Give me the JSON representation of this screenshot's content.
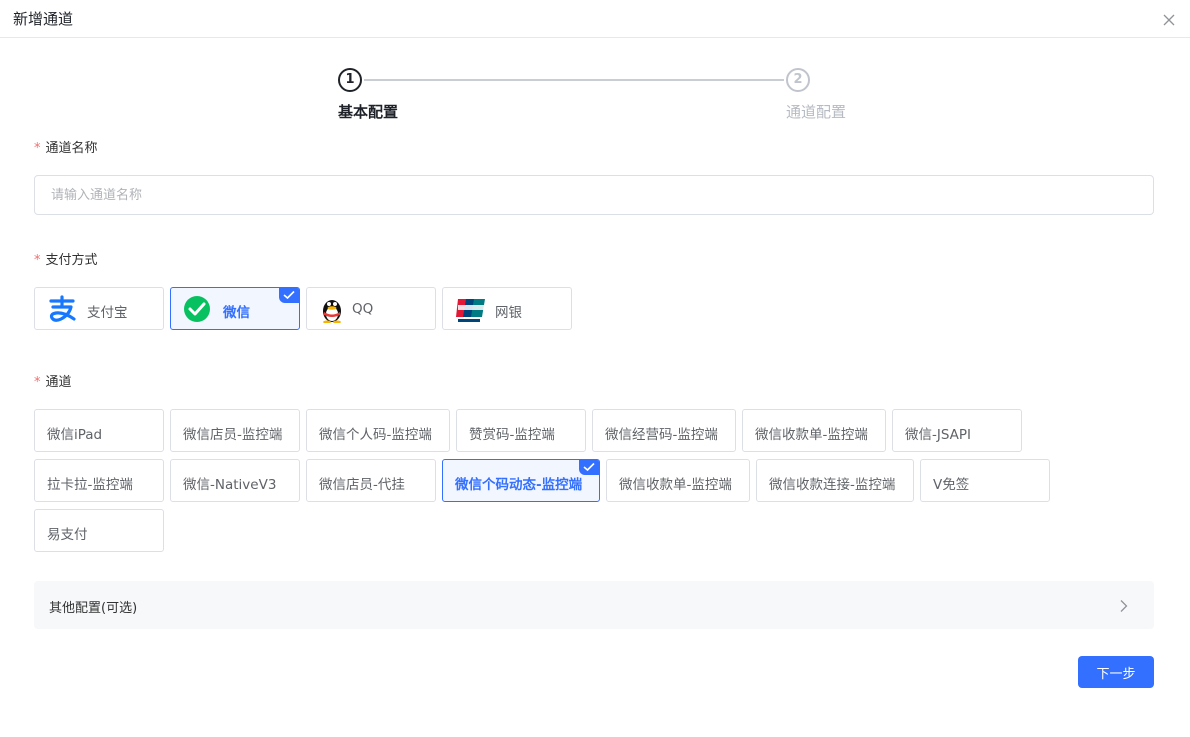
{
  "dialog": {
    "title": "新增通道"
  },
  "steps": [
    {
      "number": "1",
      "label": "基本配置",
      "state": "active"
    },
    {
      "number": "2",
      "label": "通道配置",
      "state": "pending"
    }
  ],
  "form": {
    "channel_name": {
      "label": "通道名称",
      "placeholder": "请输入通道名称",
      "value": ""
    },
    "payment_method": {
      "label": "支付方式",
      "options": [
        {
          "label": "支付宝",
          "icon": "alipay-icon",
          "selected": false
        },
        {
          "label": "微信",
          "icon": "wechat-icon",
          "selected": true
        },
        {
          "label": "QQ",
          "icon": "qq-penguin-icon",
          "selected": false
        },
        {
          "label": "网银",
          "icon": "unionpay-icon",
          "selected": false
        }
      ]
    },
    "channel": {
      "label": "通道",
      "options": [
        {
          "label": "微信iPad",
          "selected": false
        },
        {
          "label": "微信店员-监控端",
          "selected": false
        },
        {
          "label": "微信个人码-监控端",
          "selected": false
        },
        {
          "label": "赞赏码-监控端",
          "selected": false
        },
        {
          "label": "微信经营码-监控端",
          "selected": false
        },
        {
          "label": "微信收款单-监控端",
          "selected": false
        },
        {
          "label": "微信-JSAPI",
          "selected": false
        },
        {
          "label": "拉卡拉-监控端",
          "selected": false
        },
        {
          "label": "微信-NativeV3",
          "selected": false
        },
        {
          "label": "微信店员-代挂",
          "selected": false
        },
        {
          "label": "微信个码动态-监控端",
          "selected": true
        },
        {
          "label": "微信收款单-监控端",
          "selected": false
        },
        {
          "label": "微信收款连接-监控端",
          "selected": false
        },
        {
          "label": "V免签",
          "selected": false
        },
        {
          "label": "易支付",
          "selected": false
        }
      ]
    },
    "required_mark": "*"
  },
  "other_config": {
    "title": "其他配置(可选)"
  },
  "footer": {
    "next_label": "下一步"
  },
  "colors": {
    "primary": "#3370ff",
    "required": "#f56c6c",
    "wechat": "#07c160",
    "alipay": "#1677ff"
  }
}
